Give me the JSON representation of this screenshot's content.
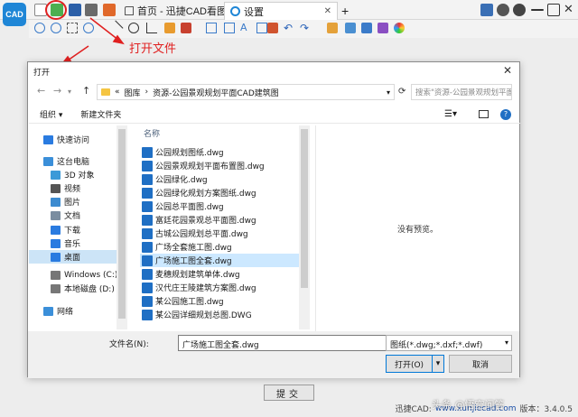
{
  "app": {
    "logo_text": "CAD",
    "tabs": [
      {
        "label": "首页 - 迅捷CAD看图"
      },
      {
        "label": "设置"
      }
    ],
    "tab_close": "✕",
    "tab_add": "+",
    "annotation": "打开文件"
  },
  "dialog": {
    "title": "打开",
    "close": "✕",
    "breadcrumb": [
      "«",
      "图库",
      "›",
      "资源-公园景观规划平面CAD建筑图"
    ],
    "search_placeholder": "搜索\"资源-公园景观规划平面...",
    "organize": "组织 ▾",
    "new_folder": "新建文件夹",
    "nav_items": [
      {
        "label": "快速访问",
        "icon": "star-icon",
        "color": "#2a7be0"
      },
      {
        "label": "这台电脑",
        "icon": "computer-icon",
        "color": "#3b8fd9"
      },
      {
        "label": "3D 对象",
        "icon": "cube-icon",
        "color": "#3c9ad8"
      },
      {
        "label": "视频",
        "icon": "video-icon",
        "color": "#555"
      },
      {
        "label": "图片",
        "icon": "picture-icon",
        "color": "#3c8bd0"
      },
      {
        "label": "文档",
        "icon": "document-icon",
        "color": "#7a8da0"
      },
      {
        "label": "下载",
        "icon": "download-icon",
        "color": "#2a7be0"
      },
      {
        "label": "音乐",
        "icon": "music-icon",
        "color": "#2a7be0"
      },
      {
        "label": "桌面",
        "icon": "desktop-icon",
        "color": "#2a7be0"
      },
      {
        "label": "Windows (C:)",
        "icon": "drive-icon",
        "color": "#777"
      },
      {
        "label": "本地磁盘 (D:)",
        "icon": "drive-icon",
        "color": "#777"
      },
      {
        "label": "网络",
        "icon": "network-icon",
        "color": "#3b8fd9"
      }
    ],
    "column_name": "名称",
    "files": [
      "公园规划图纸.dwg",
      "公园景观规划平面布置图.dwg",
      "公园绿化.dwg",
      "公园绿化规划方案图纸.dwg",
      "公园总平面图.dwg",
      "富廷花园景观总平面图.dwg",
      "古城公园规划总平面.dwg",
      "广场全套施工图.dwg",
      "广场施工图全套.dwg",
      "麦穗规划建筑单体.dwg",
      "汉代庄王陵建筑方案图.dwg",
      "某公园施工图.dwg",
      "某公园详细规划总图.DWG"
    ],
    "selected_index": 8,
    "preview_text": "没有预览。",
    "filename_label": "文件名(N):",
    "filename_value": "广场施工图全套.dwg",
    "filetype_value": "图纸(*.dwg;*.dxf;*.dwf)",
    "open_button": "打开(O)",
    "open_dropdown": "▾",
    "cancel_button": "取消"
  },
  "footer": {
    "submit": "提交",
    "brand": "迅捷CAD:",
    "url": "www.xunjiecad.com",
    "version": "版本：3.4.0.5",
    "watermark": "头条 @悟空问答"
  },
  "colors": {
    "accent": "#0078d7",
    "annotation_red": "#e02020",
    "selected_row": "#cce8ff",
    "cad_icon": "#1f6fc4"
  }
}
